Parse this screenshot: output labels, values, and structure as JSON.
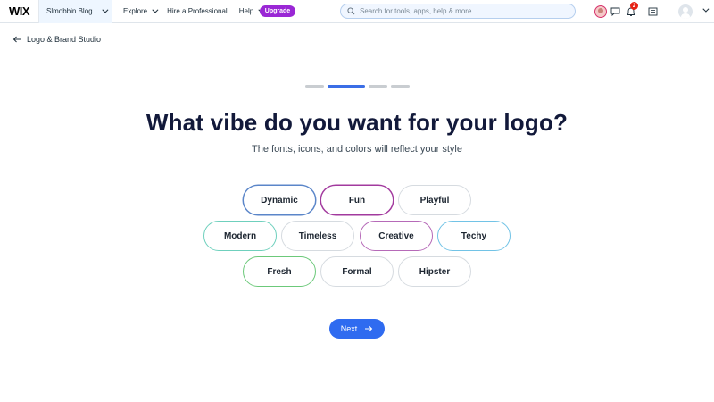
{
  "topbar": {
    "logo": "WIX",
    "site_name": "Slmobbin Blog",
    "nav": {
      "explore": "Explore",
      "hire": "Hire a Professional",
      "help": "Help"
    },
    "upgrade_label": "Upgrade",
    "search_placeholder": "Search for tools, apps, help & more...",
    "notification_count": "2"
  },
  "subheader": {
    "back_label": "Logo & Brand Studio"
  },
  "progress": {
    "total_steps": 4,
    "current_step": 2
  },
  "main": {
    "title": "What vibe do you want for your logo?",
    "subtitle": "The fonts, icons, and colors will reflect your style",
    "options": [
      {
        "label": "Dynamic",
        "border_color": "#5b86c9"
      },
      {
        "label": "Fun",
        "border_color": "#a23a9e"
      },
      {
        "label": "Playful",
        "border_color": "#d6dbe0"
      },
      {
        "label": "Modern",
        "border_color": "#6fd0bd"
      },
      {
        "label": "Timeless",
        "border_color": "#d6dbe0"
      },
      {
        "label": "Creative",
        "border_color": "#b66ab8"
      },
      {
        "label": "Techy",
        "border_color": "#72c3e6"
      },
      {
        "label": "Fresh",
        "border_color": "#6cc97a"
      },
      {
        "label": "Formal",
        "border_color": "#d6dbe0"
      },
      {
        "label": "Hipster",
        "border_color": "#d6dbe0"
      }
    ],
    "next_label": "Next"
  },
  "colors": {
    "accent": "#2f6bf0",
    "upgrade": "#9a27d5",
    "title": "#12193a"
  },
  "icons": [
    "arrow-left-icon",
    "search-icon",
    "chat-icon",
    "bell-icon",
    "news-icon",
    "arrow-right-icon"
  ]
}
